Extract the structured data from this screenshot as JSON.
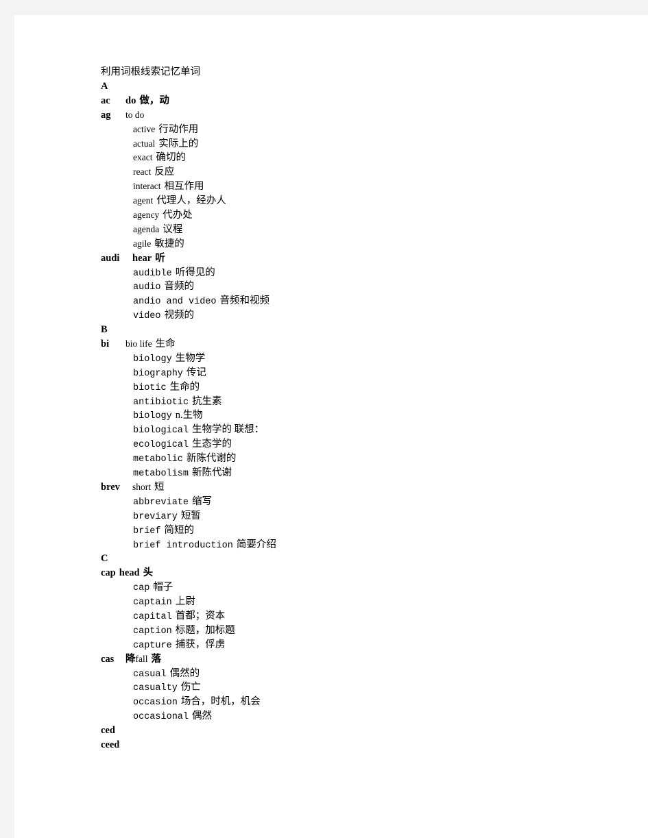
{
  "document": {
    "title": "利用词根线索记忆单词",
    "sections": [
      {
        "letter": "A",
        "roots": [
          {
            "key": "ac",
            "key_width": "k-w1",
            "gloss_en": "do",
            "gloss_en_bold": true,
            "gloss_cn": "做，动",
            "gloss_cn_bold": true,
            "entries": []
          },
          {
            "key": "ag",
            "key_width": "k-w1",
            "gloss_en": "to do",
            "gloss_en_bold": false,
            "gloss_cn": "",
            "gloss_cn_bold": false,
            "entries": [
              {
                "word": "active",
                "font": "w-serif",
                "meaning": "行动作用"
              },
              {
                "word": "actual",
                "font": "w-serif",
                "meaning": "实际上的"
              },
              {
                "word": "exact",
                "font": "w-serif",
                "meaning": "确切的"
              },
              {
                "word": "react",
                "font": "w-serif",
                "meaning": "反应"
              },
              {
                "word": "interact",
                "font": "w-serif",
                "meaning": "相互作用"
              },
              {
                "word": "agent",
                "font": "w-serif",
                "meaning": "代理人，经办人"
              },
              {
                "word": "agency",
                "font": "w-serif",
                "meaning": "代办处"
              },
              {
                "word": "agenda",
                "font": "w-serif",
                "meaning": "议程"
              },
              {
                "word": "agile",
                "font": "w-serif",
                "meaning": "敏捷的"
              }
            ]
          },
          {
            "key": "audi",
            "key_width": "k-w2",
            "gloss_en": "hear",
            "gloss_en_bold": true,
            "gloss_cn": "听",
            "gloss_cn_bold": true,
            "entries": [
              {
                "word": "audible",
                "font": "w-mono",
                "meaning": "听得见的"
              },
              {
                "word": "audio",
                "font": "w-mono",
                "meaning": "音频的"
              },
              {
                "word": "andio and video",
                "font": "w-mono",
                "meaning": "音频和视频"
              },
              {
                "word": "video",
                "font": "w-mono",
                "meaning": "视频的"
              }
            ]
          }
        ]
      },
      {
        "letter": "B",
        "roots": [
          {
            "key": "bi",
            "key_width": "k-w1",
            "gloss_en": "bio life",
            "gloss_en_bold": false,
            "gloss_cn": "生命",
            "gloss_cn_bold": false,
            "entries": [
              {
                "word": "biology",
                "font": "w-mono",
                "meaning": "生物学"
              },
              {
                "word": "biography",
                "font": "w-mono",
                "meaning": "传记"
              },
              {
                "word": "biotic",
                "font": "w-mono",
                "meaning": "生命的"
              },
              {
                "word": "antibiotic",
                "font": "w-mono",
                "meaning": "抗生素"
              },
              {
                "word": "biology",
                "font": "w-mono",
                "meaning": "n.生物"
              },
              {
                "word": "biological",
                "font": "w-mono",
                "meaning": "生物学的  联想："
              },
              {
                "word": "ecological",
                "font": "w-mono",
                "meaning": "生态学的"
              },
              {
                "word": "metabolic",
                "font": "w-mono",
                "meaning": "新陈代谢的"
              },
              {
                "word": "metabolism",
                "font": "w-mono",
                "meaning": "新陈代谢"
              }
            ]
          },
          {
            "key": "brev",
            "key_width": "k-w2",
            "gloss_en": "short",
            "gloss_en_bold": false,
            "gloss_cn": "短",
            "gloss_cn_bold": false,
            "entries": [
              {
                "word": "abbreviate",
                "font": "w-mono",
                "meaning": "缩写"
              },
              {
                "word": "breviary",
                "font": "w-mono",
                "meaning": "短暂"
              },
              {
                "word": "brief",
                "font": "w-mono",
                "meaning": "简短的"
              },
              {
                "word": "brief introduction",
                "font": "w-mono",
                "meaning": "简要介绍"
              }
            ]
          }
        ]
      },
      {
        "letter": "C",
        "roots": [
          {
            "key": "cap",
            "key_width": "",
            "gloss_en": "head",
            "gloss_en_bold": true,
            "gloss_cn": "头",
            "gloss_cn_bold": true,
            "entries": [
              {
                "word": "cap",
                "font": "w-mono",
                "meaning": "帽子"
              },
              {
                "word": "captain",
                "font": "w-mono",
                "meaning": "上尉"
              },
              {
                "word": "capital",
                "font": "w-mono",
                "meaning": "首都；资本"
              },
              {
                "word": "caption",
                "font": "w-mono",
                "meaning": "标题，加标题"
              },
              {
                "word": "capture",
                "font": "w-mono",
                "meaning": "捕获，俘虏"
              }
            ]
          },
          {
            "key": "cas",
            "key_width": "k-w1",
            "gloss_cn_pre": "降",
            "gloss_en": "fall",
            "gloss_en_bold": false,
            "gloss_cn": "落",
            "gloss_cn_bold": true,
            "entries": [
              {
                "word": "casual",
                "font": "w-mono",
                "meaning": "偶然的"
              },
              {
                "word": "casualty",
                "font": "w-mono",
                "meaning": "伤亡"
              },
              {
                "word": "occasion",
                "font": "w-mono",
                "meaning": "场合，时机，机会"
              },
              {
                "word": "occasional",
                "font": "w-mono",
                "meaning": "偶然"
              }
            ]
          },
          {
            "key": "ced",
            "key_width": "",
            "gloss_en": "",
            "gloss_en_bold": false,
            "gloss_cn": "",
            "gloss_cn_bold": false,
            "entries": []
          },
          {
            "key": "ceed",
            "key_width": "",
            "gloss_en": "",
            "gloss_en_bold": false,
            "gloss_cn": "",
            "gloss_cn_bold": false,
            "entries": []
          }
        ]
      }
    ]
  }
}
